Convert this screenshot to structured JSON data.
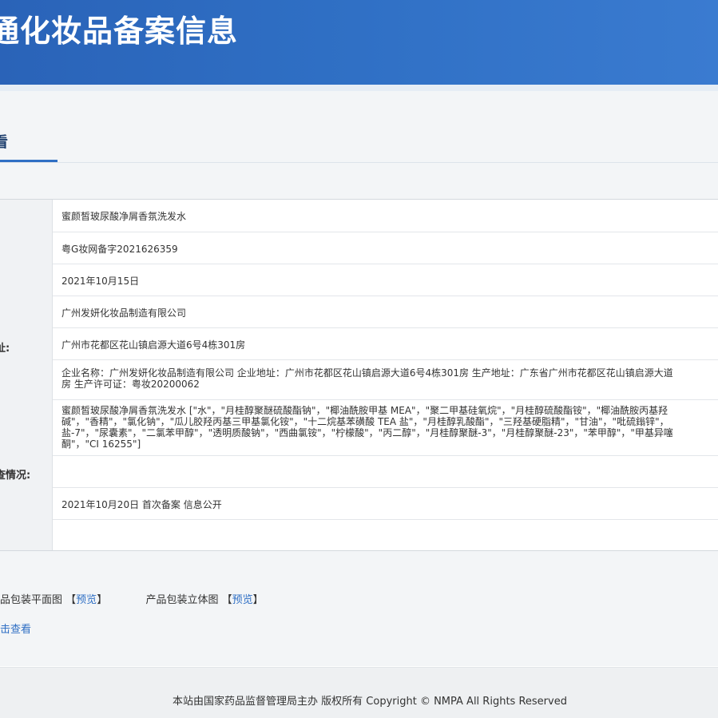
{
  "header": {
    "title": "通化妆品备案信息"
  },
  "tab": {
    "label": "看"
  },
  "labels": {
    "address": "址:",
    "inspection": "查情况:"
  },
  "rows": {
    "product_name": "蜜颜皙玻尿酸净屑香氛洗发水",
    "filing_number": "粤G妆网备字2021626359",
    "filing_date": "2021年10月15日",
    "registrant": "广州发妍化妆品制造有限公司",
    "registrant_address": "广州市花都区花山镇启源大道6号4栋301房",
    "manufacturer_line1": "企业名称：广州发妍化妆品制造有限公司 企业地址：广州市花都区花山镇启源大道6号4栋301房 生产地址：广东省广州市花都区花山镇启源大道",
    "manufacturer_line2": "房 生产许可证：粤妆20200062",
    "formula_line1": "蜜颜皙玻尿酸净屑香氛洗发水 [\"水\"，\"月桂醇聚醚硫酸酯钠\"，\"椰油酰胺甲基 MEA\"，\"聚二甲基硅氧烷\"，\"月桂醇硫酸酯铵\"，\"椰油酰胺丙基羟",
    "formula_line2": "碱\"，\"香精\"，\"氯化钠\"，\"瓜儿胶羟丙基三甲基氯化铵\"，\"十二烷基苯磺酸 TEA 盐\"，\"月桂醇乳酸酯\"，\"三羟基硬脂精\"，\"甘油\"，\"吡硫鎓锌\"，",
    "formula_line3": "盐-7\"，\"尿囊素\"，\"二氯苯甲醇\"，\"透明质酸钠\"，\"西曲氯铵\"，\"柠檬酸\"，\"丙二醇\"，\"月桂醇聚醚-3\"，\"月桂醇聚醚-23\"，\"苯甲醇\"，\"甲基异噻",
    "formula_line4": "酮\"，\"CI 16255\"]",
    "inspection_status": "",
    "history": "2021年10月20日 首次备案 信息公开"
  },
  "packaging": {
    "flat_label": "品包装平面图",
    "solid_label": "产品包装立体图",
    "preview_open": "【",
    "preview_text": "预览",
    "preview_close": "】",
    "click_view": "击查看"
  },
  "footer": {
    "text": "本站由国家药品监督管理局主办 版权所有 Copyright © NMPA All Rights Reserved"
  },
  "colors": {
    "banner": "#2f6fc4",
    "link": "#2f6fc4",
    "tab_underline": "#2f6fc4"
  }
}
